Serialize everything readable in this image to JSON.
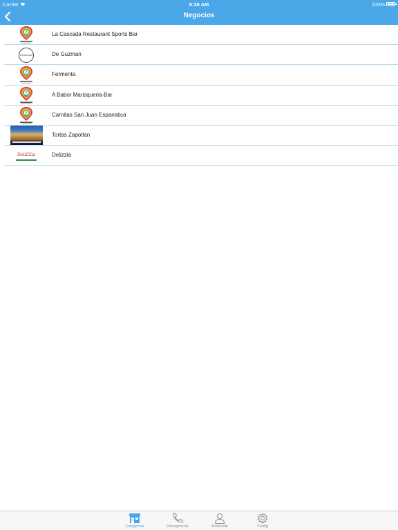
{
  "status_bar": {
    "carrier": "Carrier",
    "time": "8:36 AM",
    "battery": "100%"
  },
  "nav": {
    "title": "Negocios",
    "back_icon": "chevron-left-icon"
  },
  "businesses": [
    {
      "name": "La Cascada Restaurant Sports Bar",
      "logo": "zapotlan-pin-logo"
    },
    {
      "name": "De Guzman",
      "logo": "de-guzman-logo"
    },
    {
      "name": "Fermenta",
      "logo": "zapotlan-pin-logo"
    },
    {
      "name": "A Babor Marisqueria-Bar",
      "logo": "zapotlan-pin-logo"
    },
    {
      "name": "Carnitas San Juan Espanatica",
      "logo": "zapotlan-pin-logo"
    },
    {
      "name": "Tortas Zapotlan",
      "logo": "tortas-zapotlan-photo"
    },
    {
      "name": "Delizzia",
      "logo": "delizzia-logo"
    }
  ],
  "tabs": [
    {
      "label": "Categorías",
      "icon": "store-icon",
      "active": true
    },
    {
      "label": "Emergencias",
      "icon": "phone-icon",
      "active": false
    },
    {
      "label": "Anúnciate",
      "icon": "person-icon",
      "active": false
    },
    {
      "label": "Config",
      "icon": "gear-icon",
      "active": false
    }
  ],
  "colors": {
    "header": "#4aa8e8",
    "separator": "#bcd9ee",
    "tab_active": "#4aa8e8",
    "tab_inactive": "#8e8e93"
  }
}
